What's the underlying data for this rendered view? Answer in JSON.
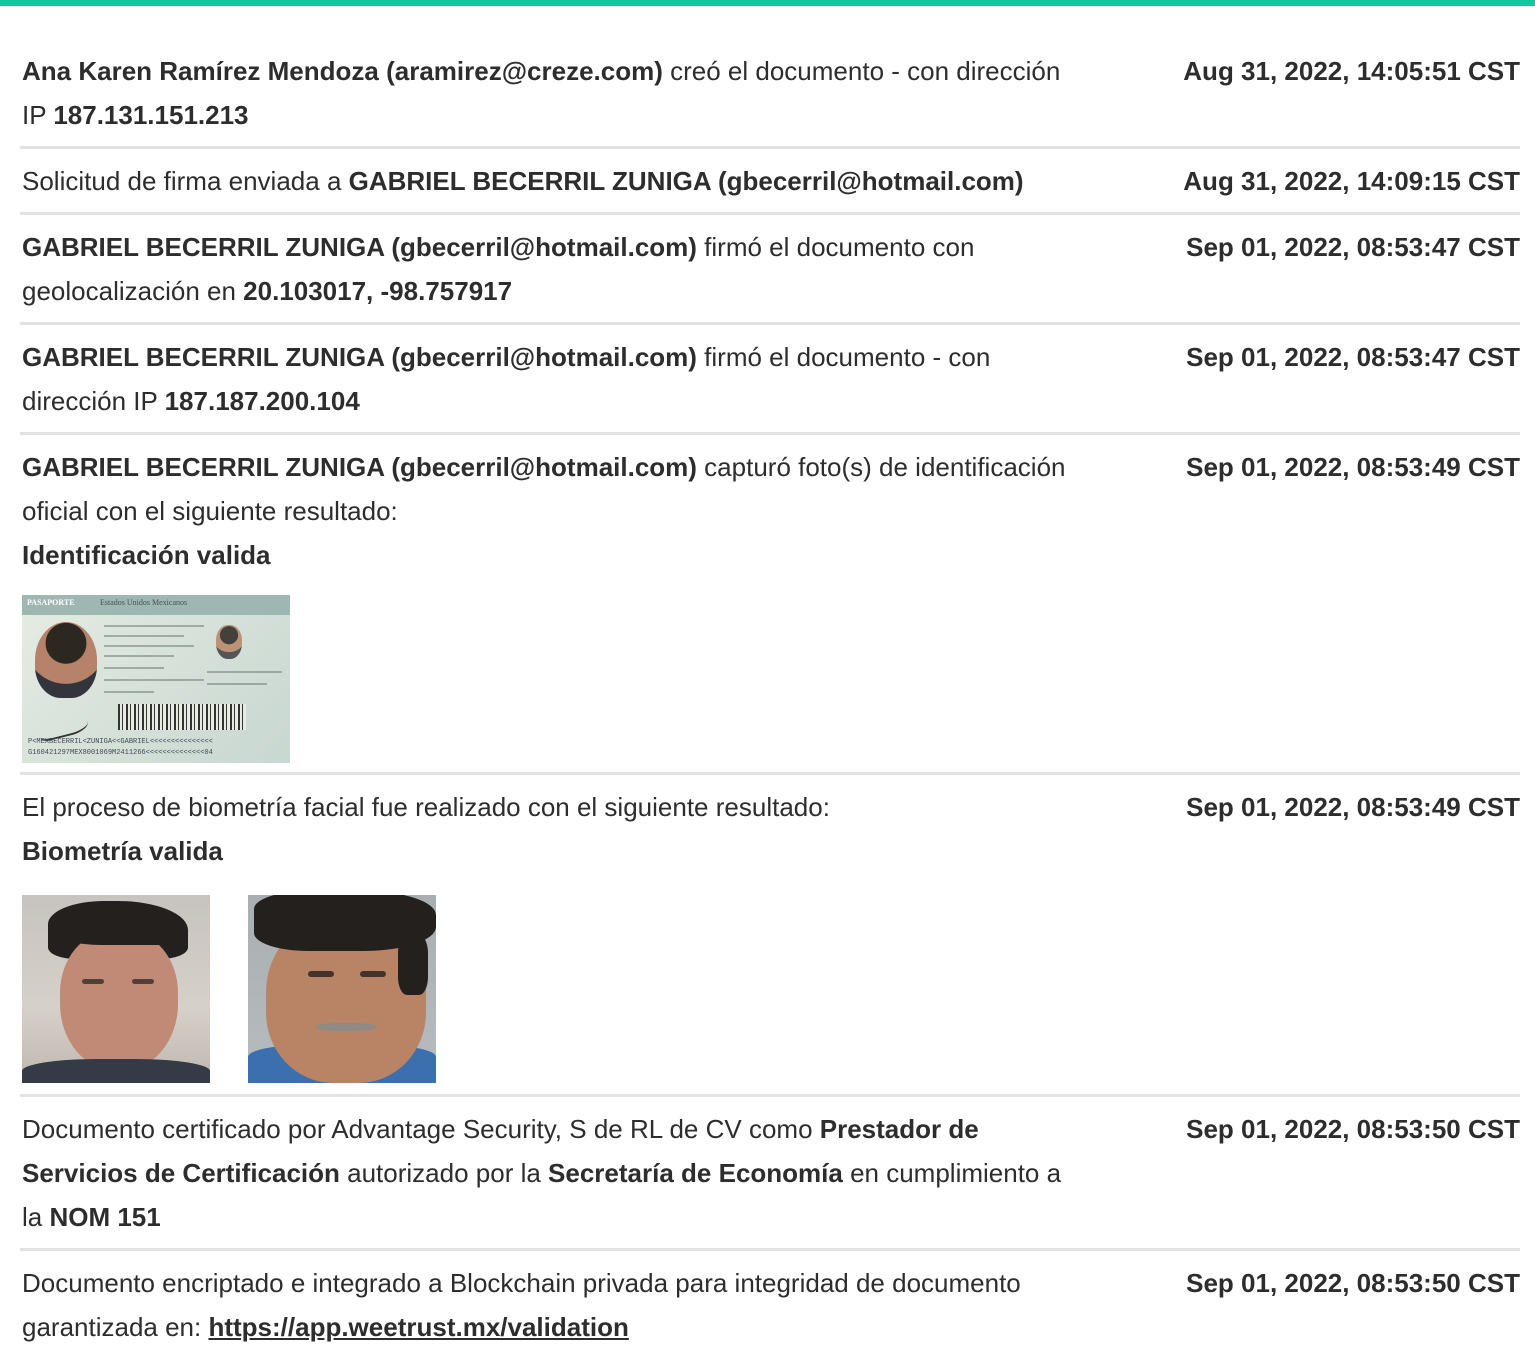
{
  "events": [
    {
      "parts": [
        {
          "b": "Ana Karen Ramírez Mendoza (aramirez@creze.com)"
        },
        {
          "t": " creó el documento - con dirección IP "
        },
        {
          "b": "187.131.151.213"
        }
      ],
      "timestamp": "Aug 31, 2022, 14:05:51 CST"
    },
    {
      "parts": [
        {
          "t": "Solicitud de firma enviada a "
        },
        {
          "b": "GABRIEL BECERRIL ZUNIGA (gbecerril@hotmail.com)"
        }
      ],
      "timestamp": "Aug 31, 2022, 14:09:15 CST"
    },
    {
      "parts": [
        {
          "b": "GABRIEL BECERRIL ZUNIGA (gbecerril@hotmail.com)"
        },
        {
          "t": " firmó el documento con geolocalización en "
        },
        {
          "b": "20.103017, -98.757917"
        }
      ],
      "timestamp": "Sep 01, 2022, 08:53:47 CST"
    },
    {
      "parts": [
        {
          "b": "GABRIEL BECERRIL ZUNIGA (gbecerril@hotmail.com)"
        },
        {
          "t": " firmó el documento - con dirección IP "
        },
        {
          "b": "187.187.200.104"
        }
      ],
      "timestamp": "Sep 01, 2022, 08:53:47 CST"
    },
    {
      "parts": [
        {
          "b": "GABRIEL BECERRIL ZUNIGA (gbecerril@hotmail.com)"
        },
        {
          "t": " capturó foto(s) de identificación oficial con el siguiente resultado:"
        },
        {
          "br": true
        },
        {
          "b": "Identificación valida"
        }
      ],
      "timestamp": "Sep 01, 2022, 08:53:49 CST",
      "image": "passport"
    },
    {
      "parts": [
        {
          "t": "El proceso de biometría facial fue realizado con el siguiente resultado:"
        },
        {
          "br": true
        },
        {
          "b": "Biometría valida"
        }
      ],
      "timestamp": "Sep 01, 2022, 08:53:49 CST",
      "image": "faces"
    },
    {
      "parts": [
        {
          "t": "Documento certificado por Advantage Security, S de RL de CV como "
        },
        {
          "b": "Prestador de Servicios de Certificación"
        },
        {
          "t": " autorizado por la "
        },
        {
          "b": "Secretaría de Economía"
        },
        {
          "t": " en cumplimiento a la "
        },
        {
          "b": "NOM 151"
        }
      ],
      "timestamp": "Sep 01, 2022, 08:53:50 CST"
    },
    {
      "parts": [
        {
          "t": "Documento encriptado e integrado a Blockchain privada para integridad de documento garantizada en: "
        },
        {
          "link": "https://app.weetrust.mx/validation"
        }
      ],
      "timestamp": "Sep 01, 2022, 08:53:50 CST"
    }
  ],
  "passport": {
    "header_label": "PASAPORTE",
    "header_country": "Estados Unidos Mexicanos",
    "mrz_line1": "P<MEXBECERRIL<ZUNIGA<<GABRIEL<<<<<<<<<<<<<<<",
    "mrz_line2": "G160421297MEX8001069M2411266<<<<<<<<<<<<<<04"
  },
  "colors": {
    "accent_bar": "#10c9a0",
    "divider": "#e3e3e3",
    "text": "#2d2d2d"
  }
}
